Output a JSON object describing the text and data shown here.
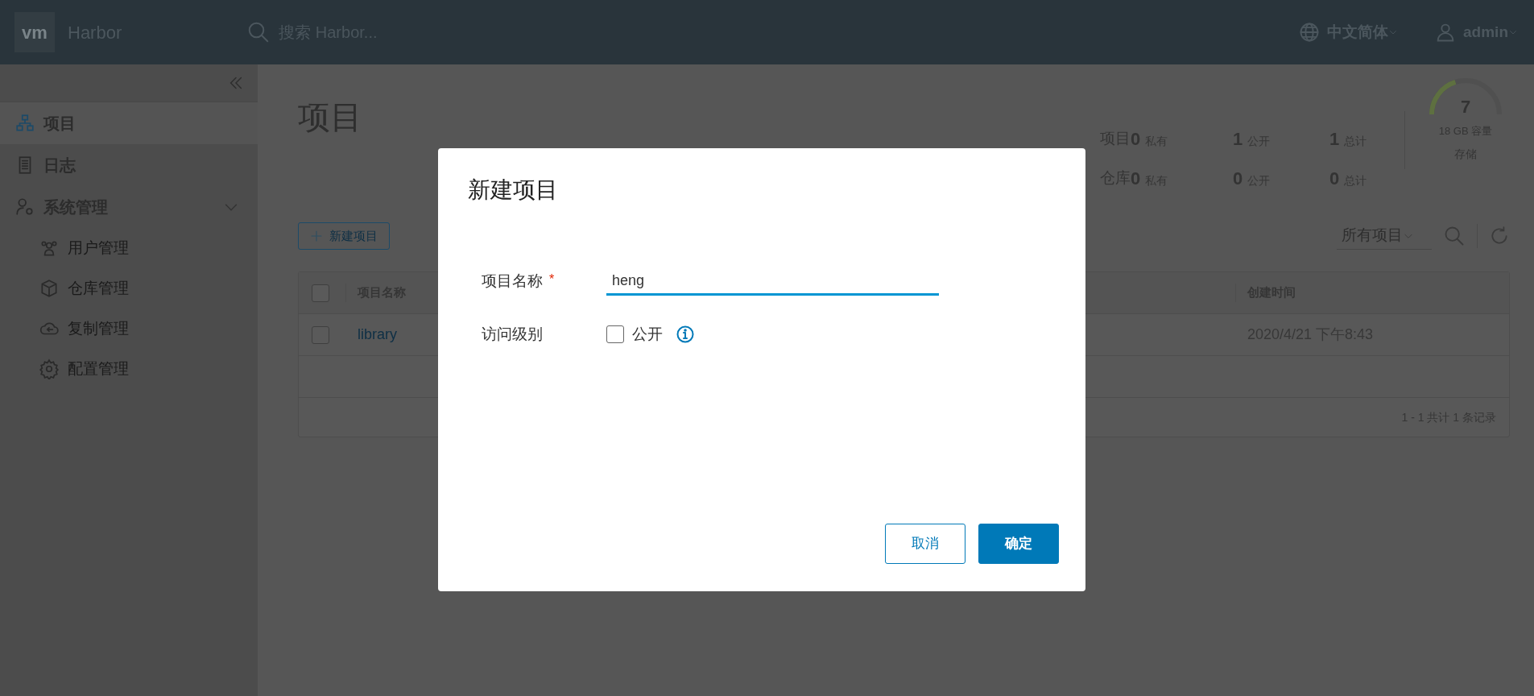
{
  "header": {
    "logo": "vm",
    "product": "Harbor",
    "search": {
      "placeholder": "搜索 Harbor..."
    },
    "language": "中文简体",
    "user": "admin"
  },
  "sidebar": {
    "items": [
      {
        "label": "项目",
        "selected": true
      },
      {
        "label": "日志",
        "selected": false
      },
      {
        "label": "系统管理",
        "selected": false,
        "expanded": true,
        "children": [
          {
            "label": "用户管理",
            "selected": false
          },
          {
            "label": "仓库管理",
            "selected": false
          },
          {
            "label": "复制管理",
            "selected": false
          },
          {
            "label": "配置管理",
            "selected": false
          }
        ]
      }
    ]
  },
  "page_title": "项目",
  "stats": {
    "rows": [
      {
        "label": "项目",
        "cells": [
          {
            "value": "0",
            "unit": "私有"
          },
          {
            "value": "1",
            "unit": "公开"
          },
          {
            "value": "1",
            "unit": "总计"
          }
        ]
      },
      {
        "label": "仓库",
        "cells": [
          {
            "value": "0",
            "unit": "私有"
          },
          {
            "value": "0",
            "unit": "公开"
          },
          {
            "value": "0",
            "unit": "总计"
          }
        ]
      }
    ],
    "storage": {
      "value": "7",
      "level": 0.35,
      "capacity": "18 GB 容量",
      "label": "存储"
    }
  },
  "toolbar": {
    "new_button": "新建项目",
    "filter": "所有项目"
  },
  "table": {
    "select_all": false,
    "columns": [
      "项目名称",
      "创建时间"
    ],
    "rows": [
      {
        "selected": false,
        "name": "library",
        "created": "2020/4/21 下午8:43"
      }
    ],
    "footer": "1 - 1 共计 1 条记录"
  },
  "dialog": {
    "title": "新建项目",
    "fields": [
      {
        "kind": "text",
        "label": "项目名称",
        "required_mark": "*",
        "value": "heng"
      },
      {
        "kind": "checkbox",
        "label": "访问级别",
        "option": "公开",
        "checked": false,
        "info": true
      }
    ],
    "buttons": [
      {
        "label": "取消",
        "kind": "secondary"
      },
      {
        "label": "确定",
        "kind": "primary"
      }
    ]
  }
}
